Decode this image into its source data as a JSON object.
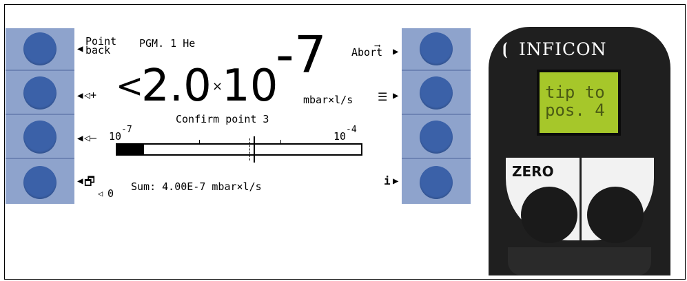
{
  "display": {
    "top_left_label_line1": "Point",
    "top_left_label_line2": "back",
    "program": "PGM. 1 He",
    "abort": "Abort",
    "volume_up": "◁+",
    "volume_down": "◁–",
    "reading_prefix": "<",
    "reading_mantissa": "2.0",
    "reading_times": "×",
    "reading_base": "10",
    "reading_exponent": "-7",
    "unit": "mbar×l/s",
    "message": "Confirm point 3",
    "scale_min_base": "10",
    "scale_min_exp": "-7",
    "scale_max_base": "10",
    "scale_max_exp": "-4",
    "sum_label": "Sum: 4.00E-7 mbar×l/s",
    "volume_level": "0",
    "info": "i",
    "bar_fill_fraction": 0.11
  },
  "device": {
    "brand": "INFICON",
    "screen_line1": "tip to",
    "screen_line2": "pos. 4",
    "zero_label": "ZERO"
  },
  "colors": {
    "softkey_column": "#8ea3cc",
    "softkey_button": "#3b61a8",
    "device_screen": "#a6c72a"
  }
}
